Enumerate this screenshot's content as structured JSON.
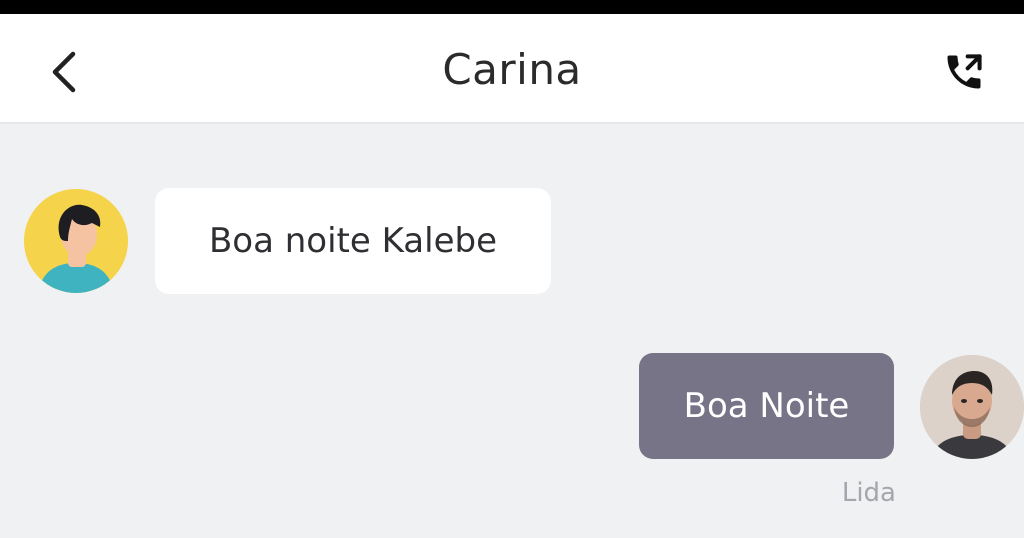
{
  "header": {
    "title": "Carina",
    "back_icon": "chevron-left-icon",
    "call_icon": "phone-outgoing-icon"
  },
  "messages": [
    {
      "direction": "incoming",
      "text": "Boa noite Kalebe",
      "avatar": "cartoon-man-avatar"
    },
    {
      "direction": "outgoing",
      "text": "Boa Noite",
      "avatar": "user-photo-avatar",
      "status": "Lida"
    }
  ],
  "colors": {
    "background": "#f0f1f3",
    "header": "#ffffff",
    "incoming_bubble": "#ffffff",
    "outgoing_bubble": "#777488",
    "avatar_yellow": "#f5d44b",
    "status_text": "#a4a6ad"
  }
}
